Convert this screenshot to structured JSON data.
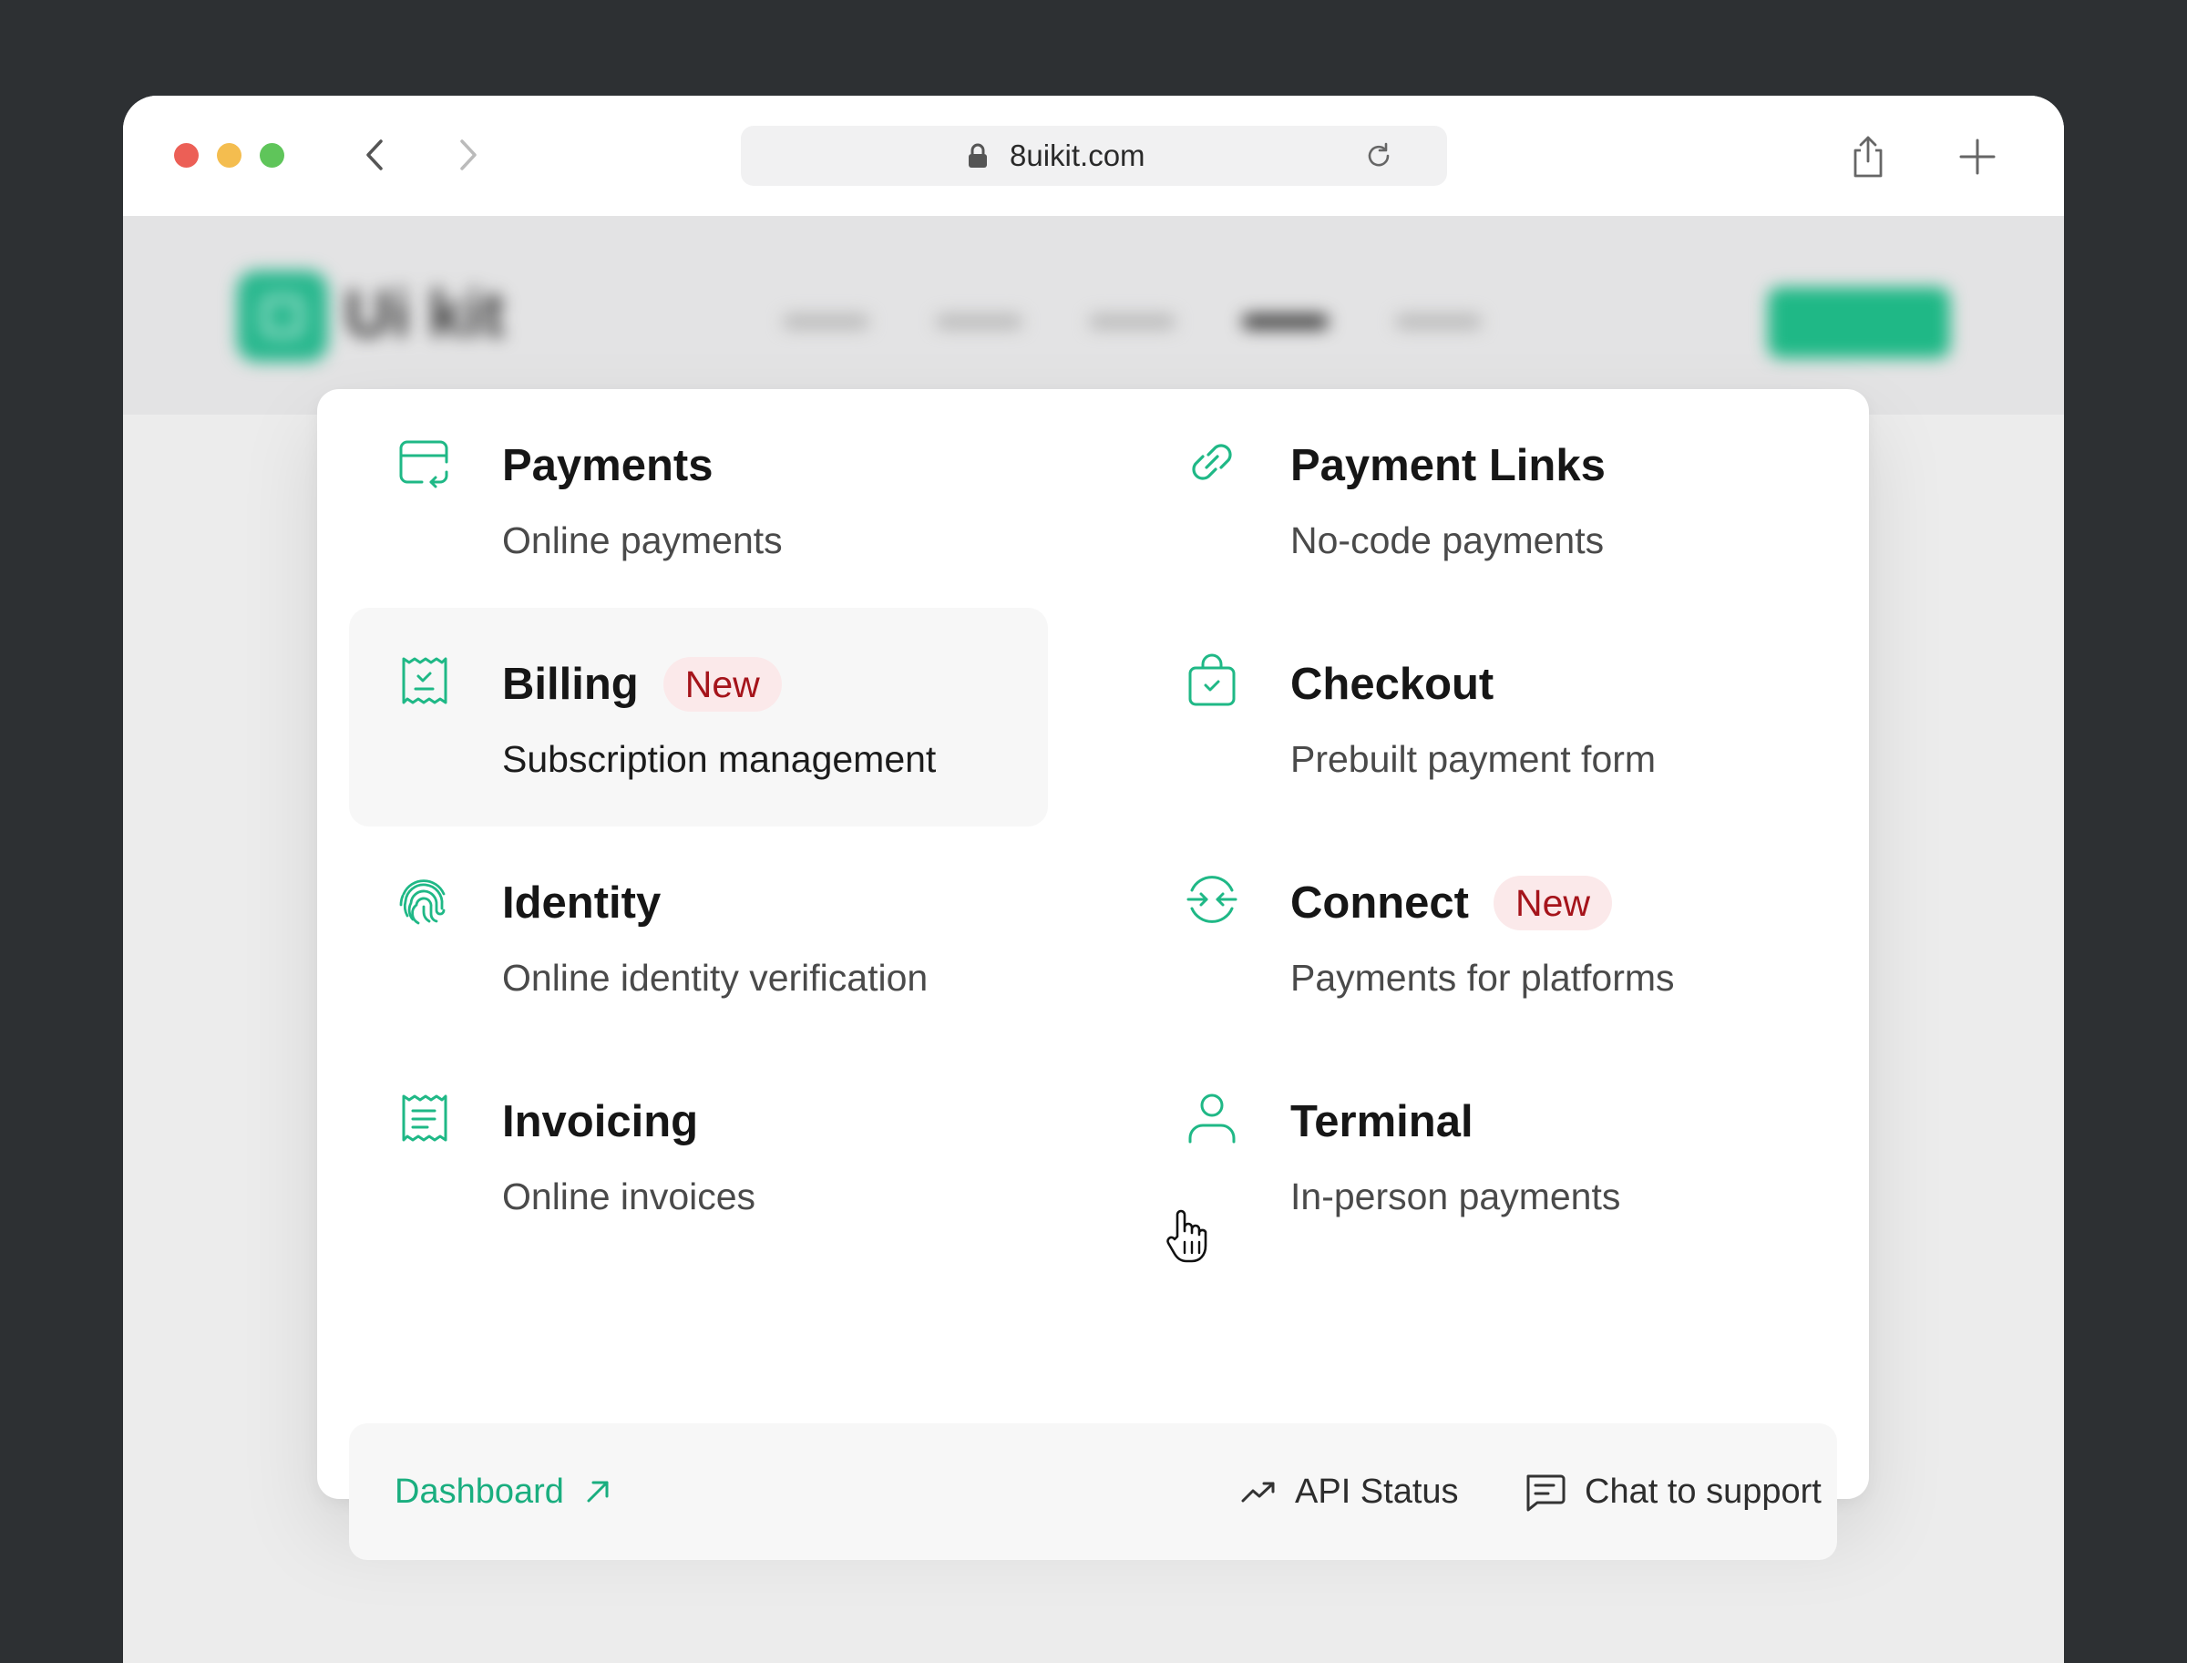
{
  "browser": {
    "url": "8uikit.com",
    "traffic_lights": [
      "#ec5f56",
      "#f4bd4f",
      "#5fc55a"
    ]
  },
  "site_header": {
    "logo_text": "Ui kit",
    "brand_color": "#27b78d"
  },
  "menu": {
    "accent_color": "#1fb886",
    "badge_color": "#a5141b",
    "items": [
      {
        "icon": "card-transfer-icon",
        "title": "Payments",
        "description": "Online payments",
        "badge": ""
      },
      {
        "icon": "link-icon",
        "title": "Payment Links",
        "description": "No-code payments",
        "badge": ""
      },
      {
        "icon": "receipt-check-icon",
        "title": "Billing",
        "description": "Subscription management",
        "badge": "New",
        "hovered": true
      },
      {
        "icon": "shopping-bag-check-icon",
        "title": "Checkout",
        "description": "Prebuilt payment form",
        "badge": ""
      },
      {
        "icon": "fingerprint-icon",
        "title": "Identity",
        "description": "Online identity verification",
        "badge": ""
      },
      {
        "icon": "arrows-converge-icon",
        "title": "Connect",
        "description": "Payments for platforms",
        "badge": "New"
      },
      {
        "icon": "document-lines-icon",
        "title": "Invoicing",
        "description": "Online invoices",
        "badge": ""
      },
      {
        "icon": "user-icon",
        "title": "Terminal",
        "description": "In-person payments",
        "badge": ""
      }
    ]
  },
  "footer": {
    "dashboard_label": "Dashboard",
    "api_status_label": "API Status",
    "support_label": "Chat to support"
  }
}
